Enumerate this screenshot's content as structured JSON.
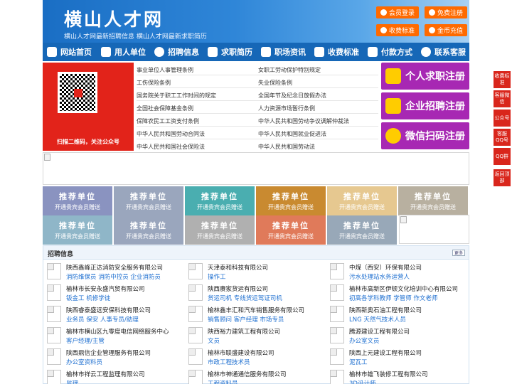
{
  "header": {
    "logo": "横山人才网",
    "tagline": "横山人才网最新招聘信息    横山人才网最新求职简历",
    "buttons": [
      {
        "label": "会员登录"
      },
      {
        "label": "免费注册"
      },
      {
        "label": "收费标准"
      },
      {
        "label": "金币充值"
      }
    ]
  },
  "nav": {
    "items": [
      {
        "label": "网站首页",
        "icon": "home-icon"
      },
      {
        "label": "用人单位",
        "icon": "building-icon"
      },
      {
        "label": "招聘信息",
        "icon": "user-icon"
      },
      {
        "label": "求职简历",
        "icon": "resume-icon"
      },
      {
        "label": "职场资讯",
        "icon": "news-icon"
      },
      {
        "label": "收费标准",
        "icon": "fee-icon"
      },
      {
        "label": "付款方式",
        "icon": "payment-icon"
      },
      {
        "label": "联系客服",
        "icon": "phone-icon"
      }
    ]
  },
  "qr": {
    "caption": "扫描二维码，关注公众号"
  },
  "policy_links": [
    "事业单位人事管理条例",
    "女职工劳动保护特别规定",
    "工伤保险条例",
    "失业保险条例",
    "国务院关于职工工作时间的规定",
    "全国年节及纪念日放假办法",
    "全国社会保障基金条例",
    "人力资源市场暂行条例",
    "保障农民工工资支付条例",
    "中华人民共和国劳动争议调解仲裁法",
    "中华人民共和国劳动合同法",
    "中华人民共和国就业促进法",
    "中华人民共和国社会保险法",
    "中华人民共和国劳动法"
  ],
  "register": [
    {
      "label": "个人求职注册"
    },
    {
      "label": "企业招聘注册"
    },
    {
      "label": "微信扫码注册"
    }
  ],
  "recommend": {
    "title": "推荐单位",
    "subtitle": "开通贵宾会员赠送",
    "colors": [
      "#8a93c0",
      "#9aa6bd",
      "#4aaeb0",
      "#c98a30",
      "#e6c890",
      "#b8b0a0",
      "#8fb6c8",
      "#9aa6bd",
      "#b0b0b0",
      "#e07a5a",
      "#98a8b8",
      "#e6d8c0"
    ]
  },
  "jobs": {
    "title": "招聘信息",
    "more": "更多",
    "items": [
      {
        "company": "陕西鑫峰正达消防安全服务有限公司",
        "positions": "消防维保员  消防中控员  企业消防员"
      },
      {
        "company": "天津泰和科技有限公司",
        "positions": "操作工"
      },
      {
        "company": "中煤（西安）环保有限公司",
        "positions": "污水处理站水务运营人"
      },
      {
        "company": "榆林市长安永盛汽贸有限公司",
        "positions": "钣金工  机修学徒"
      },
      {
        "company": "陕西赓家货运有限公司",
        "positions": "货运司机  专线货运驾证司机"
      },
      {
        "company": "榆林市高新区伊顿文化培训中心有限公司",
        "positions": "初高各学科教师  学管师  作文老师"
      },
      {
        "company": "陕西睿泰盛远安保科技有限公司",
        "positions": "业务员  保安  人事专员/助理"
      },
      {
        "company": "榆林鑫丰汇和汽车销售服务有限公司",
        "positions": "销售顾问  客户经理  市场专员"
      },
      {
        "company": "陕西新奥石油工程有限公司",
        "positions": "LNG 天然气技术人员"
      },
      {
        "company": "榆林市横山区九零度电信网络服务中心",
        "positions": "客户经理/主管"
      },
      {
        "company": "陕西裕力建筑工程有限公司",
        "positions": "文员"
      },
      {
        "company": "腾源建设工程有限公司",
        "positions": "办公室文员"
      },
      {
        "company": "陕西鼎信企业管理服务有限公司",
        "positions": "办公室资料员"
      },
      {
        "company": "榆林市联盛建设有限公司",
        "positions": "市政工程技术员"
      },
      {
        "company": "陕西上元建设工程有限公司",
        "positions": "泥瓦工"
      },
      {
        "company": "榆林市祥云工程监理有限公司",
        "positions": "监理"
      },
      {
        "company": "榆林市神通通信服务有限公司",
        "positions": "工程资料员"
      },
      {
        "company": "榆林市雄飞装修工程有限公司",
        "positions": "3D设计师"
      }
    ]
  },
  "sidebar": [
    {
      "label": "收费标准"
    },
    {
      "label": "客服微信"
    },
    {
      "label": "公众号"
    },
    {
      "label": "客服QQ号"
    },
    {
      "label": "QQ群"
    },
    {
      "label": "返回顶部"
    }
  ]
}
